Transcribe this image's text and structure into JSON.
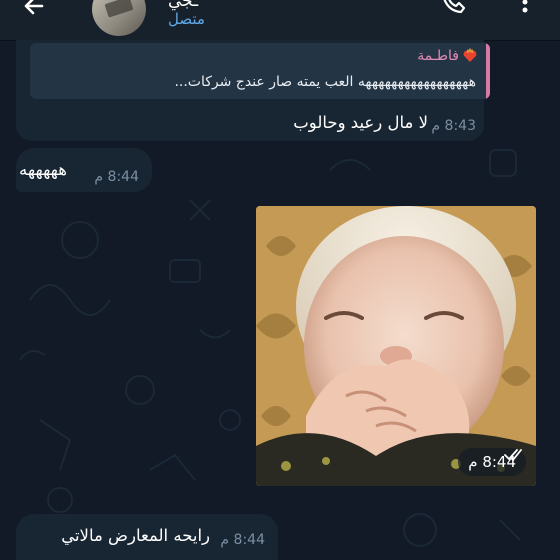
{
  "header": {
    "name": "ـجي",
    "status": "متصل"
  },
  "messages": [
    {
      "reply": {
        "author": "فاطـمة",
        "text": "هههههههههههههههههه العب يمته صار عندج شركات..."
      },
      "text": "لا مال رعيد وحالوب",
      "time": "8:43 م"
    },
    {
      "text": "هههههه",
      "time": "8:44 م"
    },
    {
      "type": "photo",
      "time": "8:44 م",
      "status_icon": "double-check-icon"
    },
    {
      "text": "رايحه المعارض مالاتي",
      "time": "8:44 م"
    }
  ],
  "colors": {
    "background": "#0e1621",
    "bubble": "#182533",
    "reply_accent": "#d77aa8",
    "status_online": "#5ea8e8"
  }
}
